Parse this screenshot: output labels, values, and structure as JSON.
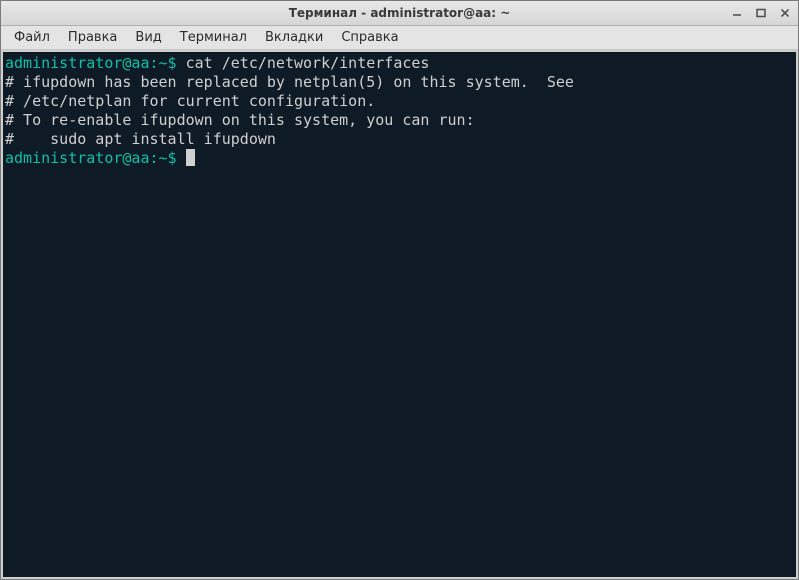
{
  "window": {
    "title": "Терминал - administrator@aa: ~"
  },
  "menubar": {
    "items": [
      "Файл",
      "Правка",
      "Вид",
      "Терминал",
      "Вкладки",
      "Справка"
    ]
  },
  "terminal": {
    "prompt": "administrator@aa:~$",
    "command": "cat /etc/network/interfaces",
    "output": [
      "# ifupdown has been replaced by netplan(5) on this system.  See",
      "# /etc/netplan for current configuration.",
      "# To re-enable ifupdown on this system, you can run:",
      "#    sudo apt install ifupdown"
    ]
  },
  "colors": {
    "terminal_bg": "#0e1a26",
    "prompt_green": "#0fc0a6",
    "text": "#cfcfcf"
  }
}
